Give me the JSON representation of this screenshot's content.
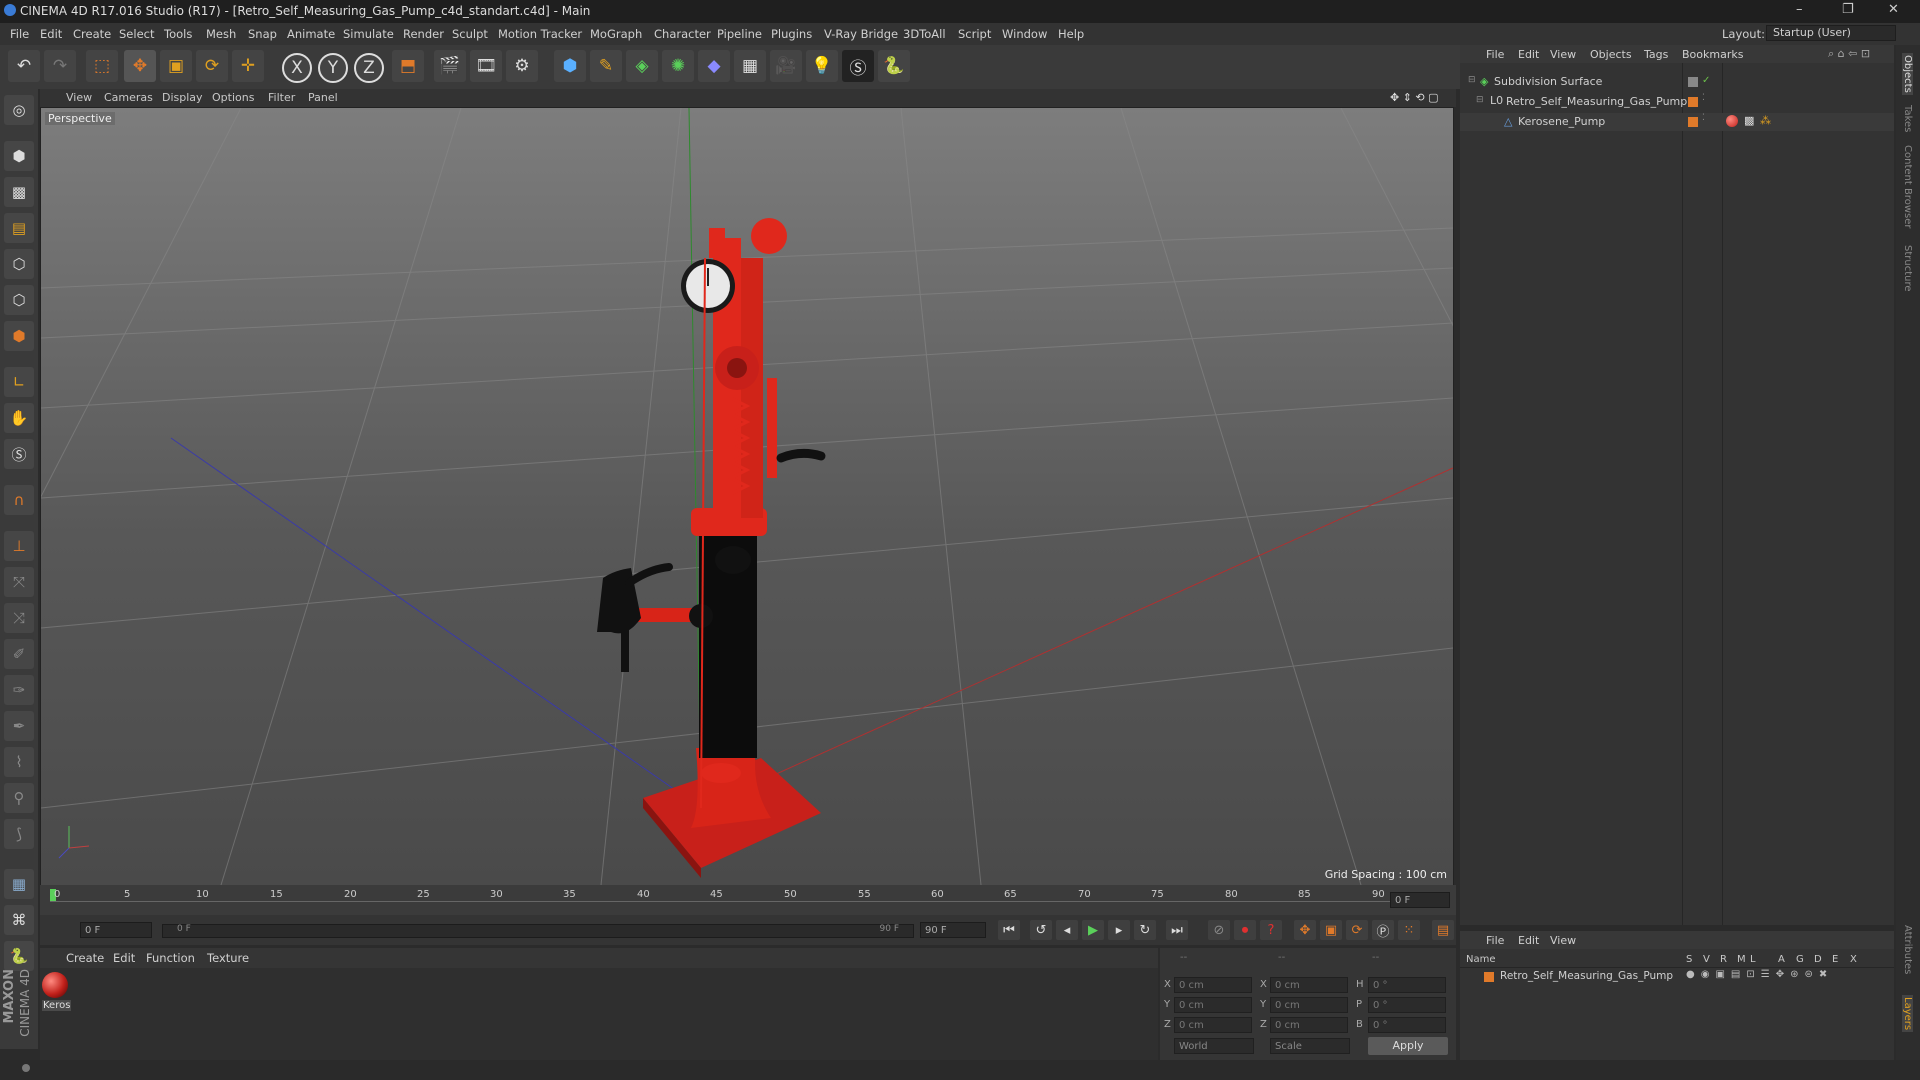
{
  "window": {
    "title": "CINEMA 4D R17.016 Studio (R17) - [Retro_Self_Measuring_Gas_Pump_c4d_standart.c4d] - Main",
    "layout_label": "Layout:",
    "layout_value": "Startup (User)",
    "minimize": "–",
    "restore": "❐",
    "close": "✕"
  },
  "menu": [
    "File",
    "Edit",
    "Create",
    "Select",
    "Tools",
    "Mesh",
    "Snap",
    "Animate",
    "Simulate",
    "Render",
    "Sculpt",
    "Motion Tracker",
    "MoGraph",
    "Character",
    "Pipeline",
    "Plugins",
    "V-Ray Bridge",
    "3DToAll",
    "Script",
    "Window",
    "Help"
  ],
  "toolbar": {
    "axis_x": "X",
    "axis_y": "Y",
    "axis_z": "Z"
  },
  "viewport": {
    "menu": [
      "View",
      "Cameras",
      "Display",
      "Options",
      "Filter",
      "Panel"
    ],
    "label": "Perspective",
    "grid_spacing": "Grid Spacing : 100 cm"
  },
  "timeline": {
    "ticks": [
      "0",
      "5",
      "10",
      "15",
      "20",
      "25",
      "30",
      "35",
      "40",
      "45",
      "50",
      "55",
      "60",
      "65",
      "70",
      "75",
      "80",
      "85",
      "90"
    ],
    "current_frame": "0 F",
    "start_field": "0 F",
    "range_start": "0 F",
    "range_end": "90 F",
    "end_field": "90 F"
  },
  "materials": {
    "menu": [
      "Create",
      "Edit",
      "Function",
      "Texture"
    ],
    "item_label": "Keros"
  },
  "coordinates": {
    "header": [
      "--",
      "--",
      "--"
    ],
    "rows": [
      {
        "a": "X",
        "av": "0 cm",
        "b": "X",
        "bv": "0 cm",
        "c": "H",
        "cv": "0 °"
      },
      {
        "a": "Y",
        "av": "0 cm",
        "b": "Y",
        "bv": "0 cm",
        "c": "P",
        "cv": "0 °"
      },
      {
        "a": "Z",
        "av": "0 cm",
        "b": "Z",
        "bv": "0 cm",
        "c": "B",
        "cv": "0 °"
      }
    ],
    "mode": "World",
    "type": "Scale",
    "apply": "Apply"
  },
  "object_manager": {
    "menu": [
      "File",
      "Edit",
      "View",
      "Objects",
      "Tags",
      "Bookmarks"
    ],
    "objects": [
      {
        "name": "Subdivision Surface"
      },
      {
        "name": "Retro_Self_Measuring_Gas_Pump"
      },
      {
        "name": "Kerosene_Pump"
      }
    ]
  },
  "layer_manager": {
    "menu": [
      "File",
      "Edit",
      "View"
    ],
    "name_header": "Name",
    "cols": [
      "S",
      "V",
      "R",
      "M",
      "L",
      "A",
      "G",
      "D",
      "E",
      "X"
    ],
    "row_name": "Retro_Self_Measuring_Gas_Pump"
  },
  "side_tabs": [
    "Objects",
    "Takes",
    "Content Browser",
    "Structure",
    "Attributes",
    "Layers"
  ],
  "brand": {
    "maxon": "MAXON",
    "c4d": "CINEMA 4D"
  },
  "colors": {
    "accent_orange": "#e07a2a",
    "pump_red": "#e0281c",
    "tag_green": "#6cc04a"
  }
}
